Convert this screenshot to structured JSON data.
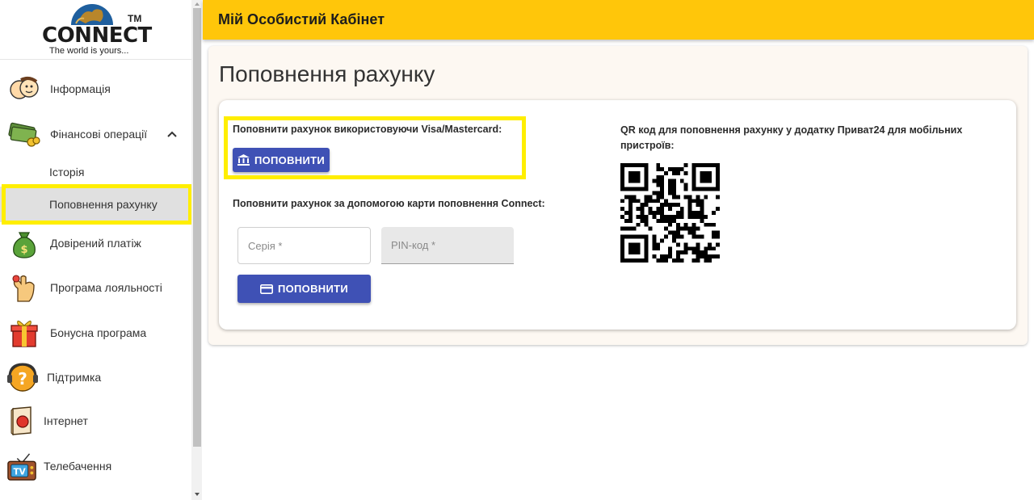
{
  "logo": {
    "brand": "CONNECT",
    "tm": "TM",
    "slogan": "The world is yours..."
  },
  "sidebar": {
    "items": [
      {
        "label": "Інформація",
        "icon": "face-icon"
      },
      {
        "label": "Фінансові операції",
        "icon": "money-icon",
        "expanded": true,
        "children": [
          {
            "label": "Історія",
            "active": false
          },
          {
            "label": "Поповнення рахунку",
            "active": true
          }
        ]
      },
      {
        "label": "Довірений платіж",
        "icon": "money-bag-icon"
      },
      {
        "label": "Програма лояльності",
        "icon": "hand-icon"
      },
      {
        "label": "Бонусна програма",
        "icon": "gift-icon"
      },
      {
        "label": "Підтримка",
        "icon": "support-icon"
      },
      {
        "label": "Інтернет",
        "icon": "internet-icon"
      },
      {
        "label": "Телебачення",
        "icon": "tv-icon"
      }
    ]
  },
  "header": {
    "title": "Мій Особистий Кабінет"
  },
  "page": {
    "title": "Поповнення рахунку"
  },
  "topup": {
    "visa_label": "Поповнити рахунок використовуючи Visa/Mastercard:",
    "visa_button": "ПОПОВНИТИ",
    "card_label": "Поповнити рахунок за допомогою карти поповнення Connect:",
    "series_placeholder": "Серія *",
    "pin_placeholder": "PIN-код *",
    "card_button": "ПОПОВНИТИ",
    "qr_label": "QR код для поповнення рахунку у додатку Приват24 для мобільних пристроїв:"
  },
  "colors": {
    "header": "#ffc60a",
    "button": "#3f51b5",
    "highlight": "#ffee00"
  }
}
